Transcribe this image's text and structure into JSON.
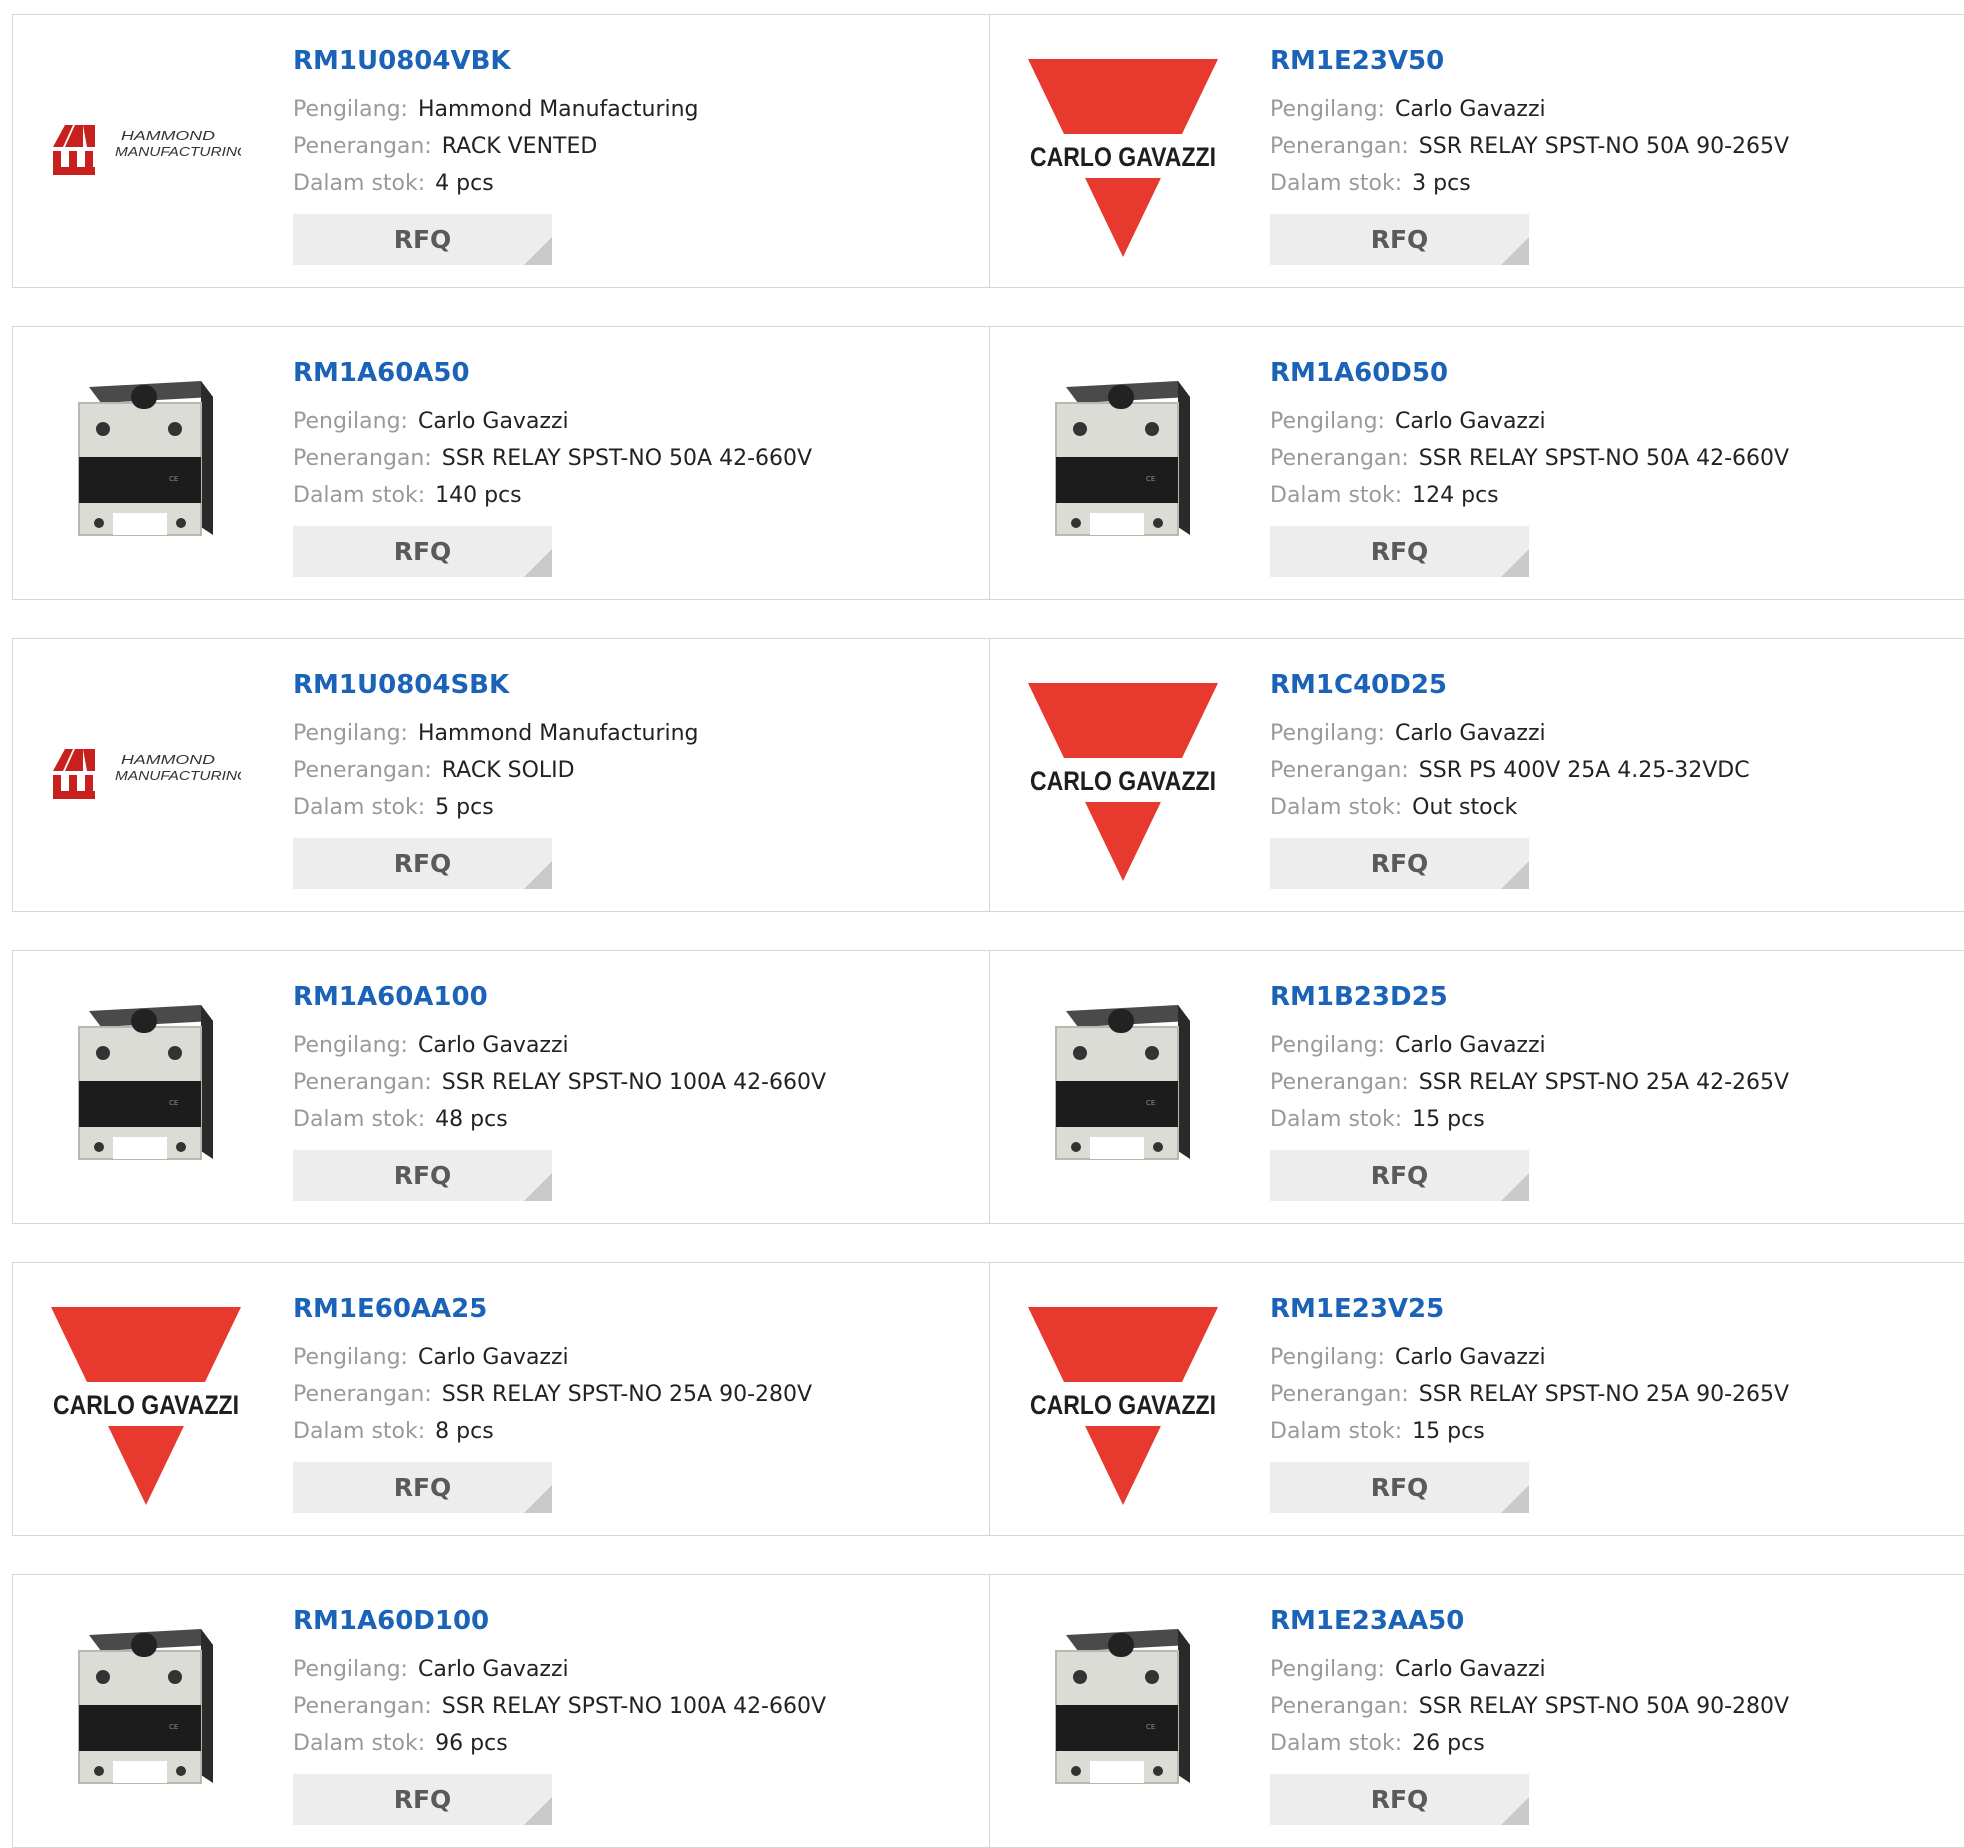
{
  "labels": {
    "manufacturer": "Pengilang:",
    "description": "Penerangan:",
    "stock": "Dalam stok:",
    "rfq": "RFQ"
  },
  "logos": {
    "hammond_line1": "HAMMOND",
    "hammond_line2": "MANUFACTURING",
    "carlo": "CARLO GAVAZZI"
  },
  "colors": {
    "part_link": "#1b63b8",
    "carlo_red": "#e8392f",
    "hammond_red": "#c8201e",
    "rfq_bg": "#ededed"
  },
  "products": [
    {
      "part": "RM1U0804VBK",
      "manufacturer": "Hammond Manufacturing",
      "description": "RACK VENTED",
      "stock": "4 pcs",
      "image": "hammond-logo"
    },
    {
      "part": "RM1E23V50",
      "manufacturer": "Carlo Gavazzi",
      "description": "SSR RELAY SPST-NO 50A 90-265V",
      "stock": "3 pcs",
      "image": "carlo-gavazzi-logo"
    },
    {
      "part": "RM1A60A50",
      "manufacturer": "Carlo Gavazzi",
      "description": "SSR RELAY SPST-NO 50A 42-660V",
      "stock": "140 pcs",
      "image": "relay-photo"
    },
    {
      "part": "RM1A60D50",
      "manufacturer": "Carlo Gavazzi",
      "description": "SSR RELAY SPST-NO 50A 42-660V",
      "stock": "124 pcs",
      "image": "relay-photo"
    },
    {
      "part": "RM1U0804SBK",
      "manufacturer": "Hammond Manufacturing",
      "description": "RACK SOLID",
      "stock": "5 pcs",
      "image": "hammond-logo"
    },
    {
      "part": "RM1C40D25",
      "manufacturer": "Carlo Gavazzi",
      "description": "SSR PS 400V 25A 4.25-32VDC",
      "stock": "Out stock",
      "image": "carlo-gavazzi-logo"
    },
    {
      "part": "RM1A60A100",
      "manufacturer": "Carlo Gavazzi",
      "description": "SSR RELAY SPST-NO 100A 42-660V",
      "stock": "48 pcs",
      "image": "relay-photo"
    },
    {
      "part": "RM1B23D25",
      "manufacturer": "Carlo Gavazzi",
      "description": "SSR RELAY SPST-NO 25A 42-265V",
      "stock": "15 pcs",
      "image": "relay-photo"
    },
    {
      "part": "RM1E60AA25",
      "manufacturer": "Carlo Gavazzi",
      "description": "SSR RELAY SPST-NO 25A 90-280V",
      "stock": "8 pcs",
      "image": "carlo-gavazzi-logo"
    },
    {
      "part": "RM1E23V25",
      "manufacturer": "Carlo Gavazzi",
      "description": "SSR RELAY SPST-NO 25A 90-265V",
      "stock": "15 pcs",
      "image": "carlo-gavazzi-logo"
    },
    {
      "part": "RM1A60D100",
      "manufacturer": "Carlo Gavazzi",
      "description": "SSR RELAY SPST-NO 100A 42-660V",
      "stock": "96 pcs",
      "image": "relay-photo"
    },
    {
      "part": "RM1E23AA50",
      "manufacturer": "Carlo Gavazzi",
      "description": "SSR RELAY SPST-NO 50A 90-280V",
      "stock": "26 pcs",
      "image": "relay-photo"
    }
  ]
}
